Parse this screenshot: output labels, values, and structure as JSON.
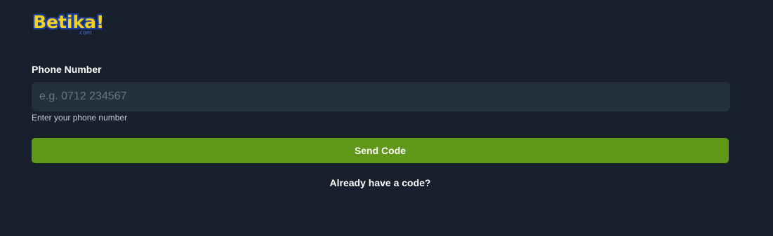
{
  "brand": {
    "name": "Betika!",
    "domain": ".com",
    "colors": {
      "yellow": "#f5d21a",
      "outline": "#1c3f9e",
      "domain_text": "#4a7ad6"
    }
  },
  "form": {
    "phone_label": "Phone Number",
    "phone_placeholder": "e.g. 0712 234567",
    "phone_value": "",
    "helper_text": "Enter your phone number",
    "send_label": "Send Code",
    "already_code_label": "Already have a code?"
  },
  "colors": {
    "background": "#17202c",
    "input_bg": "#24313c",
    "button_bg": "#5f9718",
    "text": "#ffffff"
  }
}
